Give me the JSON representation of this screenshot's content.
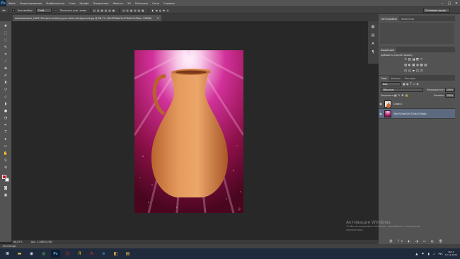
{
  "app": {
    "logo": "Ps"
  },
  "menu": [
    "Файл",
    "Редактирование",
    "Изображение",
    "Слои",
    "Шрифт",
    "Выделение",
    "Фильтр",
    "3D",
    "Просмотр",
    "Окно",
    "Справка"
  ],
  "window_controls": [
    "–",
    "□",
    "✕"
  ],
  "options": {
    "autoselect_label": "Автовыбор:",
    "autoselect_value": "Слой",
    "transform_label": "Показать упр. элем.",
    "workspace": "Основная среда"
  },
  "document_tab": {
    "title": "depositphotos_2465118-stock-photo-jug-on-white-background.jpg @ 66,7% (5fe4f53bef1e573db57e5bbc, RGB/8)",
    "close": "×"
  },
  "status": {
    "zoom": "66,67%",
    "doc": "Док: 2,08M/9,28M"
  },
  "minibridge": {
    "label": "Mini Bridge"
  },
  "panels": {
    "top_tabs": [
      "Гистограмма",
      "Навигатор"
    ],
    "adjust_tabs": [
      "Коррекция"
    ],
    "adjust_title": "Добавить корректировку",
    "layers_tabs": [
      "Слои",
      "Каналы",
      "Контуры"
    ],
    "kind_label": "Вид",
    "blend_mode": "Обычные",
    "opacity_label": "Непрозрачность:",
    "opacity_value": "100%",
    "lock_label": "Закрепить:",
    "fill_label": "Заливка:",
    "fill_value": "100%",
    "layers": [
      {
        "name": "Слой 0",
        "selected": false,
        "color": "#c86e3c"
      },
      {
        "name": "5fe4f53bef1e573db57e5bbc",
        "selected": true,
        "color": "#b3236e"
      }
    ]
  },
  "activation": {
    "title": "Активация Windows",
    "line1": "Чтобы активировать Windows, перейдите в параметры",
    "line2": "компьютера."
  },
  "taskbar": {
    "apps": [
      {
        "icon": "folder-icon",
        "glyph": "▬",
        "color": "#e8c24a"
      },
      {
        "icon": "steam-icon",
        "glyph": "◉",
        "color": "#c7d5e0"
      },
      {
        "icon": "chrome-icon",
        "glyph": "◍",
        "color": "#4caf50"
      },
      {
        "icon": "photoshop-icon",
        "glyph": "Ps",
        "color": "#4aa0e8"
      },
      {
        "icon": "opera-icon",
        "glyph": "O",
        "color": "#e0262f"
      },
      {
        "icon": "yandex-icon",
        "glyph": "Я",
        "color": "#ffcc00"
      },
      {
        "icon": "acrobat-icon",
        "glyph": "A",
        "color": "#e0262f"
      },
      {
        "icon": "ie-icon",
        "glyph": "e",
        "color": "#3fa9f5"
      },
      {
        "icon": "image-viewer-icon",
        "glyph": "◧",
        "color": "#e9b44c"
      },
      {
        "icon": "explorer-icon",
        "glyph": "▤",
        "color": "#f3c24b"
      }
    ],
    "lang": "РУС",
    "time": "20:11",
    "date": "12.11.2020"
  },
  "colors": {
    "ui_dark": "#282828",
    "ui_panel": "#535353",
    "foreground_swatch": "#d40d0d",
    "background_swatch": "#ffffff",
    "selection": "#5c6a80"
  }
}
